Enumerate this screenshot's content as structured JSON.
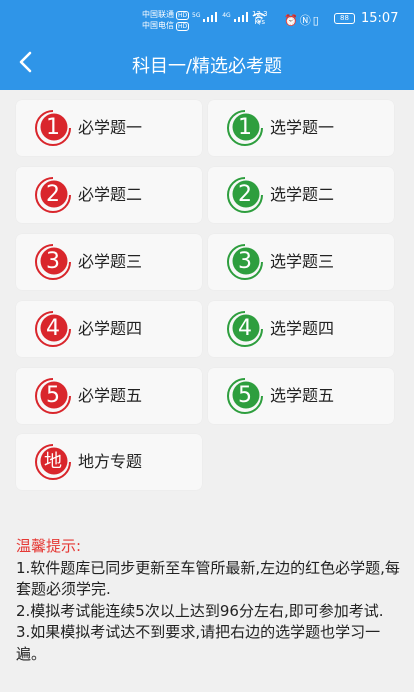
{
  "status_bar": {
    "carrier1": "中国联通",
    "carrier2": "中国电信",
    "hd": "HD",
    "net1": "5G",
    "net2": "4G",
    "speed_value": "12.3",
    "speed_unit": "K/s",
    "battery": "88",
    "time": "15:07"
  },
  "nav": {
    "title": "科目一/精选必考题"
  },
  "colors": {
    "accent": "#2f95e8",
    "required": "#d9262c",
    "optional": "#2e9e3e"
  },
  "required": [
    {
      "num": "1",
      "label": "必学题一"
    },
    {
      "num": "2",
      "label": "必学题二"
    },
    {
      "num": "3",
      "label": "必学题三"
    },
    {
      "num": "4",
      "label": "必学题四"
    },
    {
      "num": "5",
      "label": "必学题五"
    }
  ],
  "optional": [
    {
      "num": "1",
      "label": "选学题一"
    },
    {
      "num": "2",
      "label": "选学题二"
    },
    {
      "num": "3",
      "label": "选学题三"
    },
    {
      "num": "4",
      "label": "选学题四"
    },
    {
      "num": "5",
      "label": "选学题五"
    }
  ],
  "local": {
    "num": "地",
    "label": "地方专题"
  },
  "tips": {
    "title": "温馨提示:",
    "lines": [
      "1.软件题库已同步更新至车管所最新,左边的红色必学题,每套题必须学完.",
      "2.模拟考试能连续5次以上达到96分左右,即可参加考试.",
      "3.如果模拟考试达不到要求,请把右边的选学题也学习一遍。"
    ]
  }
}
